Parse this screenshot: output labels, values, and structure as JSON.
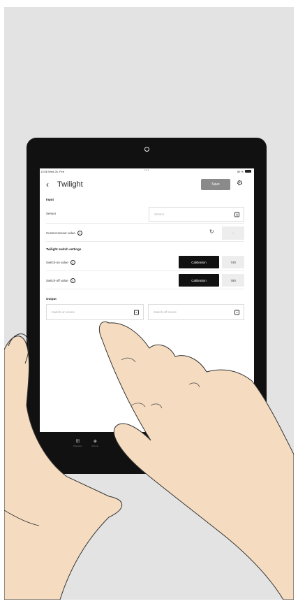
{
  "status_bar": {
    "time": "13:56  Wed 26. Feb",
    "dots": "•••",
    "battery": "89 %"
  },
  "header": {
    "back_glyph": "‹",
    "title": "Twilight",
    "save_label": "Save",
    "settings_icon": "gear-icon"
  },
  "input_section": {
    "label": "Input",
    "sensor": {
      "label": "Sensor",
      "placeholder": "Sensor"
    },
    "current_value": {
      "label": "Current sensor value",
      "value": "-"
    }
  },
  "twilight_section": {
    "label": "Twilight switch settings",
    "switch_on": {
      "label": "Switch-on value",
      "button": "Calibration",
      "value": "740"
    },
    "switch_off": {
      "label": "Switch-off value",
      "button": "Calibration",
      "value": "760"
    }
  },
  "output_section": {
    "label": "Output",
    "switch_on_scene": {
      "placeholder": "Switch-on scene"
    },
    "switch_off_scene": {
      "placeholder": "Switch-off scene"
    }
  },
  "bottom_nav": [
    {
      "label": "Overview",
      "icon": "grid-icon"
    },
    {
      "label": "Rooms",
      "icon": "layers-icon"
    }
  ],
  "colors": {
    "background": "#e3e3e3",
    "tablet": "#111111",
    "save_button": "#8a8a8a",
    "calibration_button": "#111111",
    "skin": "#f5dcc0"
  }
}
